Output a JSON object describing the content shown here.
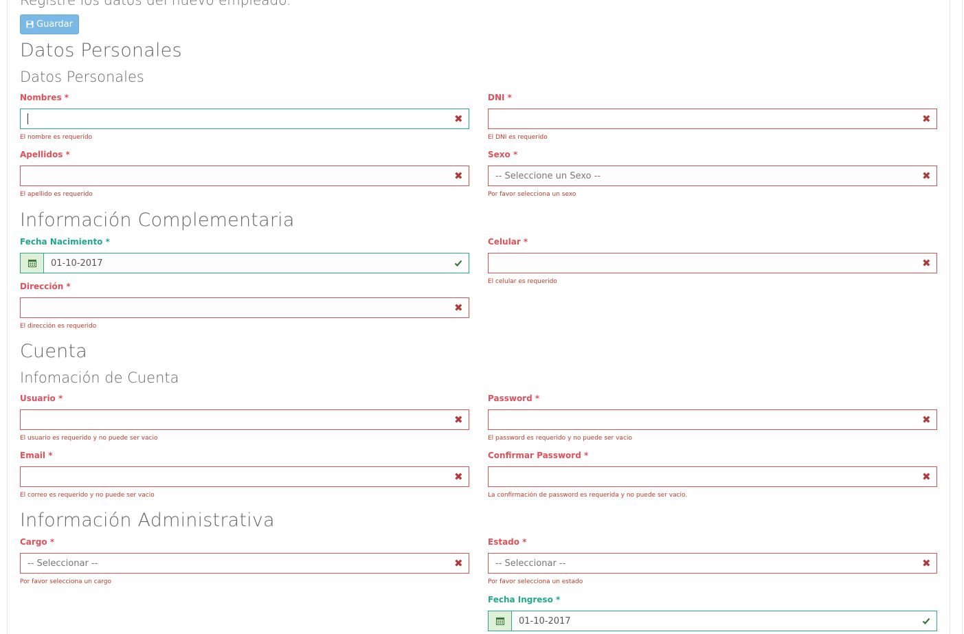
{
  "intro": "Registre los datos del nuevo empleado.",
  "save_button": {
    "label": "Guardar",
    "icon": "floppy-disk-icon"
  },
  "sections": {
    "personal_title": "Datos Personales",
    "personal_subtitle": "Datos Personales",
    "complementary_title": "Información Complementaria",
    "account_title": "Cuenta",
    "account_subtitle": "Infomación de Cuenta",
    "admin_title": "Información Administrativa"
  },
  "fields": {
    "nombres": {
      "label": "Nombres *",
      "value": "",
      "help": "El nombre es requerido",
      "status": "error"
    },
    "dni": {
      "label": "DNI *",
      "value": "",
      "help": "El DNI es requerido",
      "status": "error"
    },
    "apellidos": {
      "label": "Apellidos *",
      "value": "",
      "help": "El apellido es requerido",
      "status": "error"
    },
    "sexo": {
      "label": "Sexo *",
      "value": "-- Seleccione un Sexo --",
      "help": "Por favor selecciona un sexo",
      "status": "error"
    },
    "fecha_nacimiento": {
      "label": "Fecha Nacimiento *",
      "value": "01-10-2017",
      "status": "success"
    },
    "celular": {
      "label": "Celular *",
      "value": "",
      "help": "El celular es requerido",
      "status": "error"
    },
    "direccion": {
      "label": "Dirección *",
      "value": "",
      "help": "El dirección es requerido",
      "status": "error"
    },
    "usuario": {
      "label": "Usuario *",
      "value": "",
      "help": "El usuario es requerido y no puede ser vacio",
      "status": "error"
    },
    "password": {
      "label": "Password *",
      "value": "",
      "help": "El password es requerido y no puede ser vacio",
      "status": "error"
    },
    "email": {
      "label": "Email *",
      "value": "",
      "help": "El correo es requerido y no puede ser vacio",
      "status": "error"
    },
    "confirmar_password": {
      "label": "Confirmar Password *",
      "value": "",
      "help": "La confirmación de password es requerida y no puede ser vacio.",
      "status": "error"
    },
    "cargo": {
      "label": "Cargo *",
      "value": "-- Seleccionar --",
      "help": "Por favor selecciona un cargo",
      "status": "error"
    },
    "estado": {
      "label": "Estado *",
      "value": "-- Seleccionar --",
      "help": "Por favor selecciona un estado",
      "status": "error"
    },
    "fecha_ingreso": {
      "label": "Fecha Ingreso *",
      "value": "01-10-2017",
      "status": "success"
    }
  },
  "colors": {
    "error": "#d9534f",
    "success": "#27a98a",
    "button": "#7ab8e6"
  }
}
